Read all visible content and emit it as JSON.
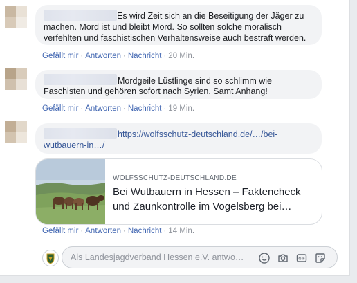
{
  "comments": [
    {
      "text": "Es wird Zeit sich an die Beseitigung der Jäger zu machen. Mord ist und bleibt Mord. So sollten solche moralisch verfehlten und faschistischen Verhaltensweise auch bestraft werden.",
      "line1": "Es wird Zeit sich an die Beseitigung der Jäger zu",
      "line2": "machen. Mord ist und bleibt Mord. So sollten solche moralisch",
      "line3": "verfehlten und faschistischen Verhaltensweise auch bestraft werden.",
      "like": "Gefällt mir",
      "reply": "Antworten",
      "message": "Nachricht",
      "time": "20 Min."
    },
    {
      "line1": "Mordgeile Lüstlinge sind so schlimm wie",
      "line2": "Faschisten und gehören sofort nach Syrien. Samt Anhang!",
      "like": "Gefällt mir",
      "reply": "Antworten",
      "message": "Nachricht",
      "time": "19 Min."
    },
    {
      "link_line1": "https://wolfsschutz-deutschland.de/…/bei-",
      "link_line2": "wutbauern-in…/",
      "like": "Gefällt mir",
      "reply": "Antworten",
      "message": "Nachricht",
      "time": "14 Min."
    }
  ],
  "link_preview": {
    "domain": "WOLFSSCHUTZ-DEUTSCHLAND.DE",
    "title_line1": "Bei Wutbauern in Hessen – Faktencheck",
    "title_line2": "und Zaunkontrolle im Vogelsberg bei…"
  },
  "reply_box": {
    "placeholder": "Als Landesjagdverband Hessen e.V. antwo…"
  },
  "icons": [
    "emoji-icon",
    "camera-icon",
    "gif-icon",
    "sticker-icon"
  ],
  "colors": {
    "link": "#385898",
    "action": "#4267b2",
    "meta": "#90949c",
    "bubble": "#f2f3f5"
  }
}
